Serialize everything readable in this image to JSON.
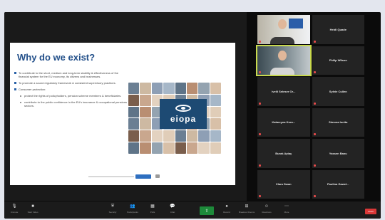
{
  "slide": {
    "title": "Why do we exist?",
    "bullets": [
      "To contribute to the short, medium and long-term stability & effectiveness of the financial system for the EU economy, its citizens and businesses.",
      "To promote a sound regulatory framework & consistent supervisory practices.",
      "Consumer protection:"
    ],
    "sub_bullets": [
      "protect the rights of policyholders, pension scheme members & beneficiaries.",
      "contribute to the public confidence in the EU's insurance & occupational pensions sectors."
    ],
    "logo_text": "eiopa"
  },
  "participants": [
    {
      "name": "",
      "has_video": true,
      "video_style": "office"
    },
    {
      "name": "Heidi Quade",
      "has_video": false
    },
    {
      "name": "",
      "has_video": true,
      "video_style": "home",
      "active_speaker": true
    },
    {
      "name": "Philip Wilson",
      "has_video": false
    },
    {
      "name": "Iveili Seleser Or...",
      "has_video": false
    },
    {
      "name": "Sylvie Cullen",
      "has_video": false
    },
    {
      "name": "Katarzyna Kora...",
      "has_video": false
    },
    {
      "name": "Simona Ionita",
      "has_video": false
    },
    {
      "name": "Burak Aytaç",
      "has_video": false
    },
    {
      "name": "Yassen Banu",
      "has_video": false
    },
    {
      "name": "Clara Dwan",
      "has_video": false
    },
    {
      "name": "Paulina Gaweł...",
      "has_video": false
    }
  ],
  "toolbar": {
    "left": [
      {
        "glyph": "🎙",
        "label": "Unmute"
      },
      {
        "glyph": "■",
        "label": "Start Video"
      }
    ],
    "center": [
      {
        "glyph": "⛨",
        "label": "Security"
      },
      {
        "glyph": "👥",
        "label": "Participants"
      },
      {
        "glyph": "▦",
        "label": "Polls"
      },
      {
        "glyph": "💬",
        "label": "Chat"
      },
      {
        "glyph": "●",
        "label": "Record"
      },
      {
        "glyph": "⊞",
        "label": "Breakout Rooms"
      },
      {
        "glyph": "☺",
        "label": "Reactions"
      },
      {
        "glyph": "⋯",
        "label": "More"
      }
    ],
    "leave_label": "Leave"
  },
  "colors": {
    "accent_blue": "#23508a",
    "logo_bg": "#1d4a73",
    "active_speaker": "#c9d94e",
    "leave_red": "#d93838",
    "share_green": "#1d8a3a"
  }
}
